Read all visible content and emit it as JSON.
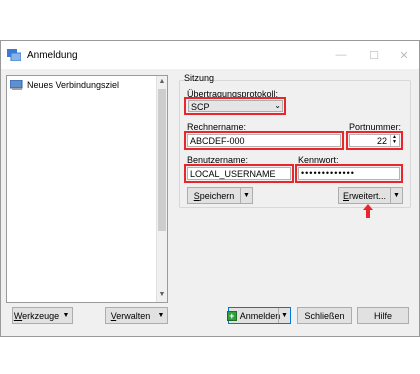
{
  "window": {
    "title": "Anmeldung",
    "controls": {
      "minimize": "—",
      "maximize": "☐",
      "close": "✕"
    }
  },
  "site_list": {
    "items": [
      {
        "label": "Neues Verbindungsziel"
      }
    ]
  },
  "session": {
    "group_label": "Sitzung",
    "protocol_label_prefix": "Ü",
    "protocol_label_rest": "bertragungsprotokoll:",
    "protocol_value": "SCP",
    "host_label_prefix": "R",
    "host_label_rest": "echnername:",
    "host_value": "ABCDEF-000",
    "port_label_prefix": "P",
    "port_label_rest": "ortnummer:",
    "port_value": "22",
    "user_label_prefix": "B",
    "user_label_rest": "enutzername:",
    "user_value": "LOCAL_USERNAME",
    "password_label_prefix": "K",
    "password_label_rest": "ennwort:",
    "password_value": "•••••••••••••",
    "save_prefix": "S",
    "save_rest": "peichern",
    "advanced_prefix": "E",
    "advanced_rest": "rweitert..."
  },
  "footer": {
    "tools_prefix": "W",
    "tools_rest": "erkzeuge",
    "manage_prefix": "V",
    "manage_rest": "erwalten",
    "login_label": "Anmelden",
    "close_label": "Schließen",
    "help_label": "Hilfe"
  },
  "colors": {
    "highlight": "#e8262c",
    "accent": "#0078d7",
    "login_icon": "#2e9e3e"
  }
}
